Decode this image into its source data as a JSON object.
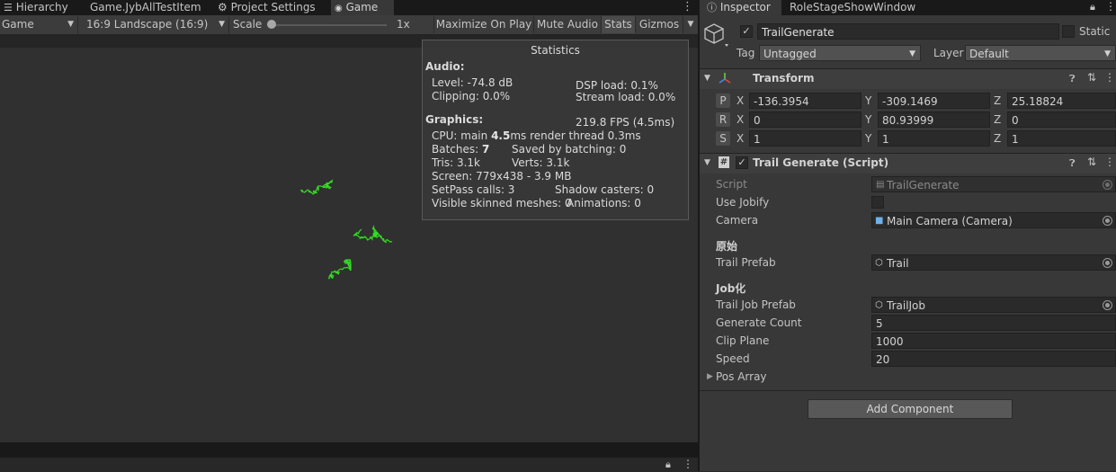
{
  "left_tabs": [
    {
      "label": "Hierarchy",
      "icon": "list-icon"
    },
    {
      "label": "Game.JybAllTestItem"
    },
    {
      "label": "Project Settings",
      "icon": "gear-icon"
    },
    {
      "label": "Game",
      "icon": "gamepad-icon",
      "active": true
    }
  ],
  "game_toolbar": {
    "display": "Game",
    "aspect": "16:9 Landscape (16:9)",
    "scale_label": "Scale",
    "scale_value": "1x",
    "maximize": "Maximize On Play",
    "mute": "Mute Audio",
    "stats": "Stats",
    "gizmos": "Gizmos"
  },
  "stats": {
    "title": "Statistics",
    "audio_header": "Audio:",
    "level": "Level: -74.8 dB",
    "clipping": "Clipping: 0.0%",
    "dsp": "DSP load: 0.1%",
    "stream": "Stream load: 0.0%",
    "graphics_header": "Graphics:",
    "fps": "219.8 FPS (4.5ms)",
    "cpu_prefix": "CPU: main ",
    "cpu_main": "4.5",
    "cpu_suffix": "ms  render thread 0.3ms",
    "batches_prefix": "Batches: ",
    "batches": "7",
    "saved": "Saved by batching: 0",
    "tris": "Tris: 3.1k",
    "verts": "Verts: 3.1k",
    "screen": "Screen: 779x438 - 3.9 MB",
    "setpass": "SetPass calls: 3",
    "shadow": "Shadow casters: 0",
    "skinned": "Visible skinned meshes: 0",
    "animations": "Animations: 0"
  },
  "right_tabs": [
    {
      "label": "Inspector",
      "icon": "info-icon",
      "active": true
    },
    {
      "label": "RoleStageShowWindow"
    }
  ],
  "object": {
    "active": true,
    "name": "TrailGenerate",
    "static_label": "Static",
    "tag_label": "Tag",
    "tag": "Untagged",
    "layer_label": "Layer",
    "layer": "Default"
  },
  "transform": {
    "title": "Transform",
    "rows": [
      {
        "pill": "P",
        "x": "-136.3954",
        "y": "-309.1469",
        "z": "25.18824"
      },
      {
        "pill": "R",
        "x": "0",
        "y": "80.93999",
        "z": "0"
      },
      {
        "pill": "S",
        "x": "1",
        "y": "1",
        "z": "1"
      }
    ],
    "axis_x": "X",
    "axis_y": "Y",
    "axis_z": "Z"
  },
  "script_comp": {
    "title": "Trail Generate (Script)",
    "enabled": true,
    "script_label": "Script",
    "script_value": "TrailGenerate",
    "use_jobify_label": "Use Jobify",
    "use_jobify": false,
    "camera_label": "Camera",
    "camera_value": "Main Camera (Camera)",
    "section1": "原始",
    "trail_prefab_label": "Trail Prefab",
    "trail_prefab_value": "Trail",
    "section2": "Job化",
    "trail_job_prefab_label": "Trail Job Prefab",
    "trail_job_prefab_value": "TrailJob",
    "generate_count_label": "Generate Count",
    "generate_count": "5",
    "clip_plane_label": "Clip Plane",
    "clip_plane": "1000",
    "speed_label": "Speed",
    "speed": "20",
    "pos_array_label": "Pos Array"
  },
  "add_component": "Add Component",
  "colors": {
    "trail": "#33dd22",
    "panel_bg": "#383838",
    "field_bg": "#2a2a2a"
  }
}
